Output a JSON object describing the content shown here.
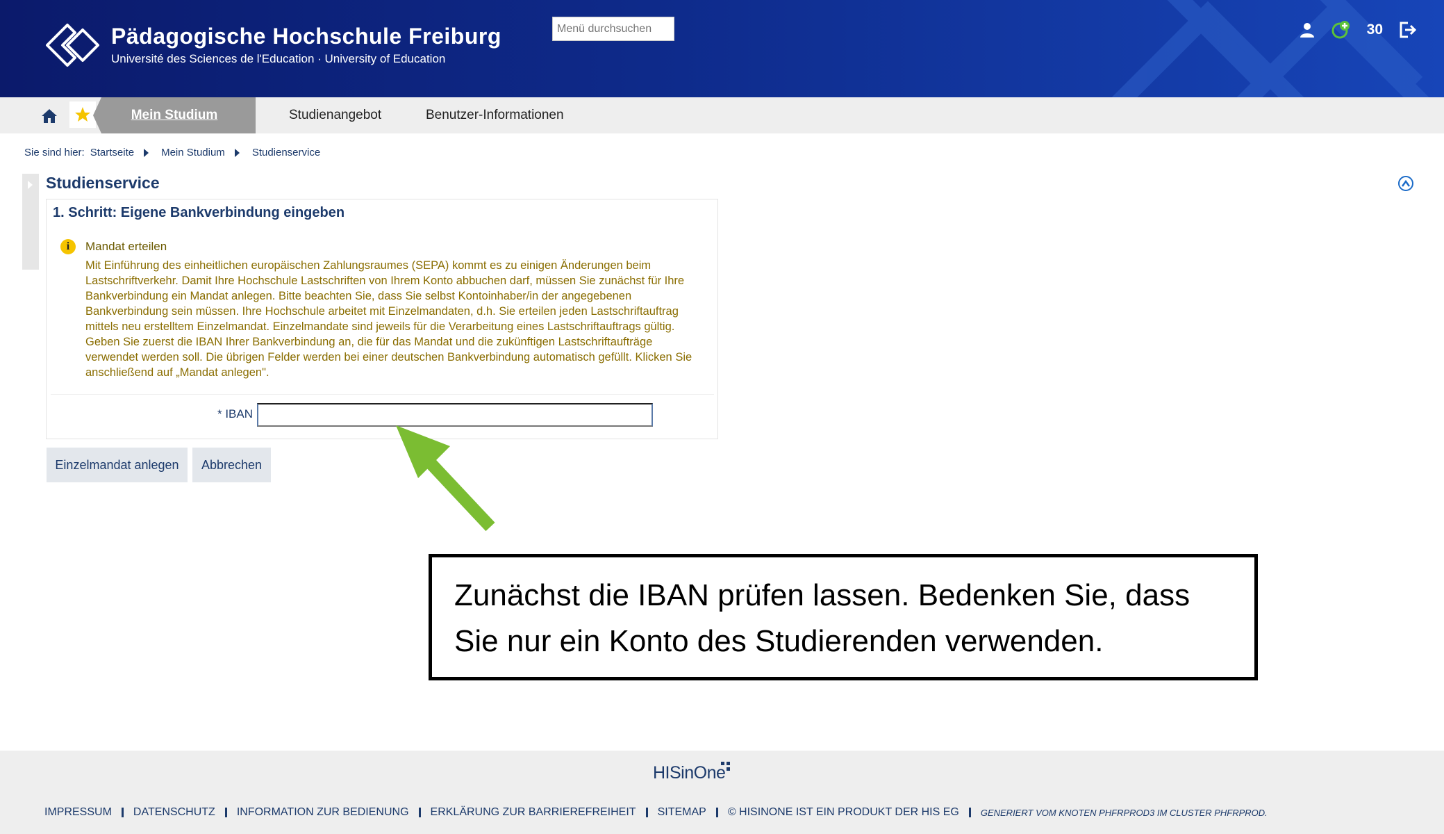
{
  "header": {
    "title": "Pädagogische Hochschule Freiburg",
    "subtitle": "Université des Sciences de l'Education · University of Education",
    "search_placeholder": "Menü durchsuchen",
    "count": "30"
  },
  "nav": {
    "active_tab": "Mein Studium",
    "tabs": [
      "Studienangebot",
      "Benutzer-Informationen"
    ]
  },
  "breadcrumb": {
    "prefix": "Sie sind hier:",
    "items": [
      "Startseite",
      "Mein Studium",
      "Studienservice"
    ]
  },
  "page_title": "Studienservice",
  "panel": {
    "step_title": "1. Schritt: Eigene Bankverbindung eingeben",
    "info_heading": "Mandat erteilen",
    "info_text": "Mit Einführung des einheitlichen europäischen Zahlungsraumes (SEPA) kommt es zu einigen Änderungen beim Lastschriftverkehr. Damit Ihre Hochschule Lastschriften von Ihrem Konto abbuchen darf, müssen Sie zunächst für Ihre Bankverbindung ein Mandat anlegen. Bitte beachten Sie, dass Sie selbst Kontoinhaber/in der angegebenen Bankverbindung sein müssen. Ihre Hochschule arbeitet mit Einzelmandaten, d.h. Sie erteilen jeden Lastschriftauftrag mittels neu erstelltem Einzelmandat. Einzelmandate sind jeweils für die Verarbeitung eines Lastschriftauftrags gültig. Geben Sie zuerst die IBAN Ihrer Bankverbindung an, die für das Mandat und die zukünftigen Lastschriftaufträge verwendet werden soll. Die übrigen Felder werden bei einer deutschen Bankverbindung automatisch gefüllt. Klicken Sie anschließend auf „Mandat anlegen\".",
    "iban_label": "* IBAN",
    "iban_value": ""
  },
  "buttons": {
    "create": "Einzelmandat anlegen",
    "cancel": "Abbrechen"
  },
  "callout": {
    "line1": "Zunächst die IBAN prüfen lassen. Bedenken Sie, dass",
    "line2": "Sie nur ein Konto des Studierenden verwenden."
  },
  "footer": {
    "logo": "HISinOne",
    "links": [
      "IMPRESSUM",
      "DATENSCHUTZ",
      "INFORMATION ZUR BEDIENUNG",
      "ERKLÄRUNG ZUR BARRIEREFREIHEIT",
      "SITEMAP",
      "© HISINONE IST EIN PRODUKT DER HIS EG"
    ],
    "generated": "GENERIERT VOM KNOTEN PHFRPROD3 IM CLUSTER PHFRPROD."
  },
  "colors": {
    "header_dark": "#0b1a6b",
    "header_light": "#1745b8",
    "nav_active": "#9a9a9a",
    "info_text": "#8a6d00",
    "arrow": "#7bbd32",
    "link": "#1c3a6b"
  },
  "icons": [
    "home-icon",
    "star-icon",
    "user-icon",
    "notification-icon",
    "logout-icon",
    "info-icon",
    "collapse-up-icon"
  ]
}
